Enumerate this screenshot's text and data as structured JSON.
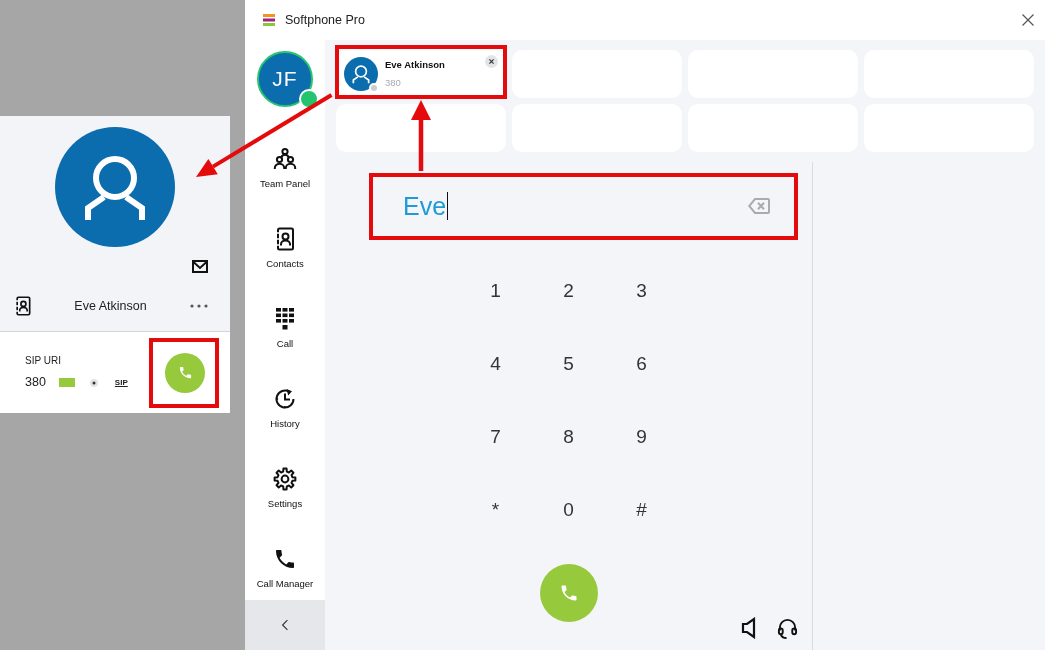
{
  "contact_card": {
    "name": "Eve Atkinson",
    "field_label": "SIP URI",
    "number": "380",
    "protocol": "SIP"
  },
  "window": {
    "title": "Softphone Pro"
  },
  "user": {
    "initials": "JF",
    "status": {
      "color": "#22c46e"
    }
  },
  "sidebar": {
    "items": [
      {
        "label": "Team Panel",
        "kind": "team",
        "selected": false
      },
      {
        "label": "Contacts",
        "kind": "contacts",
        "selected": false
      },
      {
        "label": "Call",
        "kind": "dialpad",
        "selected": false
      },
      {
        "label": "History",
        "kind": "history",
        "selected": false
      },
      {
        "label": "Settings",
        "kind": "settings",
        "selected": false
      },
      {
        "label": "Call Manager",
        "kind": "phone",
        "selected": false
      }
    ]
  },
  "speed_dial": {
    "tiles": [
      {
        "kind": "contact",
        "name": "Eve Atkinson",
        "number": "380",
        "status": {
          "color": "#c9ccd2"
        }
      },
      {
        "kind": "empty"
      },
      {
        "kind": "empty"
      },
      {
        "kind": "empty"
      },
      {
        "kind": "empty"
      },
      {
        "kind": "empty"
      },
      {
        "kind": "empty"
      },
      {
        "kind": "empty"
      }
    ]
  },
  "dialer": {
    "input": {
      "value": "Eve"
    },
    "keys": [
      "1",
      "2",
      "3",
      "4",
      "5",
      "6",
      "7",
      "8",
      "9",
      "*",
      "0",
      "#"
    ]
  }
}
